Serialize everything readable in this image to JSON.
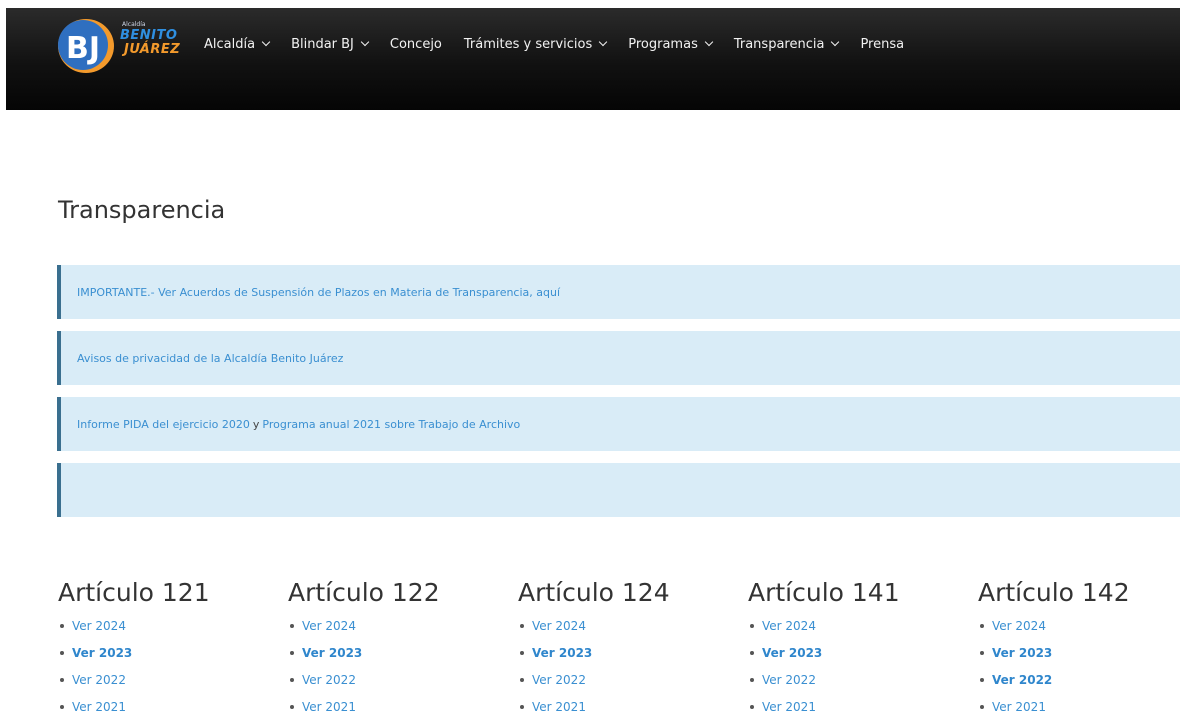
{
  "header": {
    "logo": {
      "small_text": "Alcaldía",
      "line1": "BENITO",
      "line2": "JUÁREZ",
      "mark": "BJ"
    },
    "nav": [
      {
        "label": "Alcaldía",
        "has_dropdown": true
      },
      {
        "label": "Blindar BJ",
        "has_dropdown": true
      },
      {
        "label": "Concejo",
        "has_dropdown": false
      },
      {
        "label": "Trámites y servicios",
        "has_dropdown": true
      },
      {
        "label": "Programas",
        "has_dropdown": true
      },
      {
        "label": "Transparencia",
        "has_dropdown": true
      },
      {
        "label": "Prensa",
        "has_dropdown": false
      }
    ]
  },
  "main": {
    "title": "Transparencia",
    "notices": [
      {
        "link": "IMPORTANTE.- Ver Acuerdos de Suspensión de Plazos en Materia de Transparencia, aquí"
      },
      {
        "link": "Avisos de privacidad de la Alcaldía Benito Juárez"
      },
      {
        "link_a": "Informe PIDA del ejercicio 2020",
        "joiner": "y",
        "link_b": "Programa anual 2021 sobre Trabajo de Archivo"
      },
      {
        "link": ""
      }
    ],
    "articles": [
      {
        "title": "Artículo 121",
        "links": [
          {
            "label": "Ver 2024",
            "bold": false
          },
          {
            "label": "Ver 2023",
            "bold": true
          },
          {
            "label": "Ver 2022",
            "bold": false
          },
          {
            "label": "Ver 2021",
            "bold": false
          }
        ]
      },
      {
        "title": "Artículo 122",
        "links": [
          {
            "label": "Ver 2024",
            "bold": false
          },
          {
            "label": "Ver 2023",
            "bold": true
          },
          {
            "label": "Ver 2022",
            "bold": false
          },
          {
            "label": "Ver 2021",
            "bold": false
          }
        ]
      },
      {
        "title": "Artículo 124",
        "links": [
          {
            "label": "Ver 2024",
            "bold": false
          },
          {
            "label": "Ver 2023",
            "bold": true
          },
          {
            "label": "Ver 2022",
            "bold": false
          },
          {
            "label": "Ver 2021",
            "bold": false
          }
        ]
      },
      {
        "title": "Artículo 141",
        "links": [
          {
            "label": "Ver 2024",
            "bold": false
          },
          {
            "label": "Ver 2023",
            "bold": true
          },
          {
            "label": "Ver 2022",
            "bold": false
          },
          {
            "label": "Ver 2021",
            "bold": false
          }
        ]
      },
      {
        "title": "Artículo 142",
        "links": [
          {
            "label": "Ver 2024",
            "bold": false
          },
          {
            "label": "Ver 2023",
            "bold": true
          },
          {
            "label": "Ver 2022",
            "bold": true
          },
          {
            "label": "Ver 2021",
            "bold": false
          }
        ]
      }
    ]
  },
  "colors": {
    "navbar": "#111111",
    "link": "#3a8fd1",
    "notice_bg": "#d9ecf7",
    "notice_border": "#3a6f8f"
  }
}
